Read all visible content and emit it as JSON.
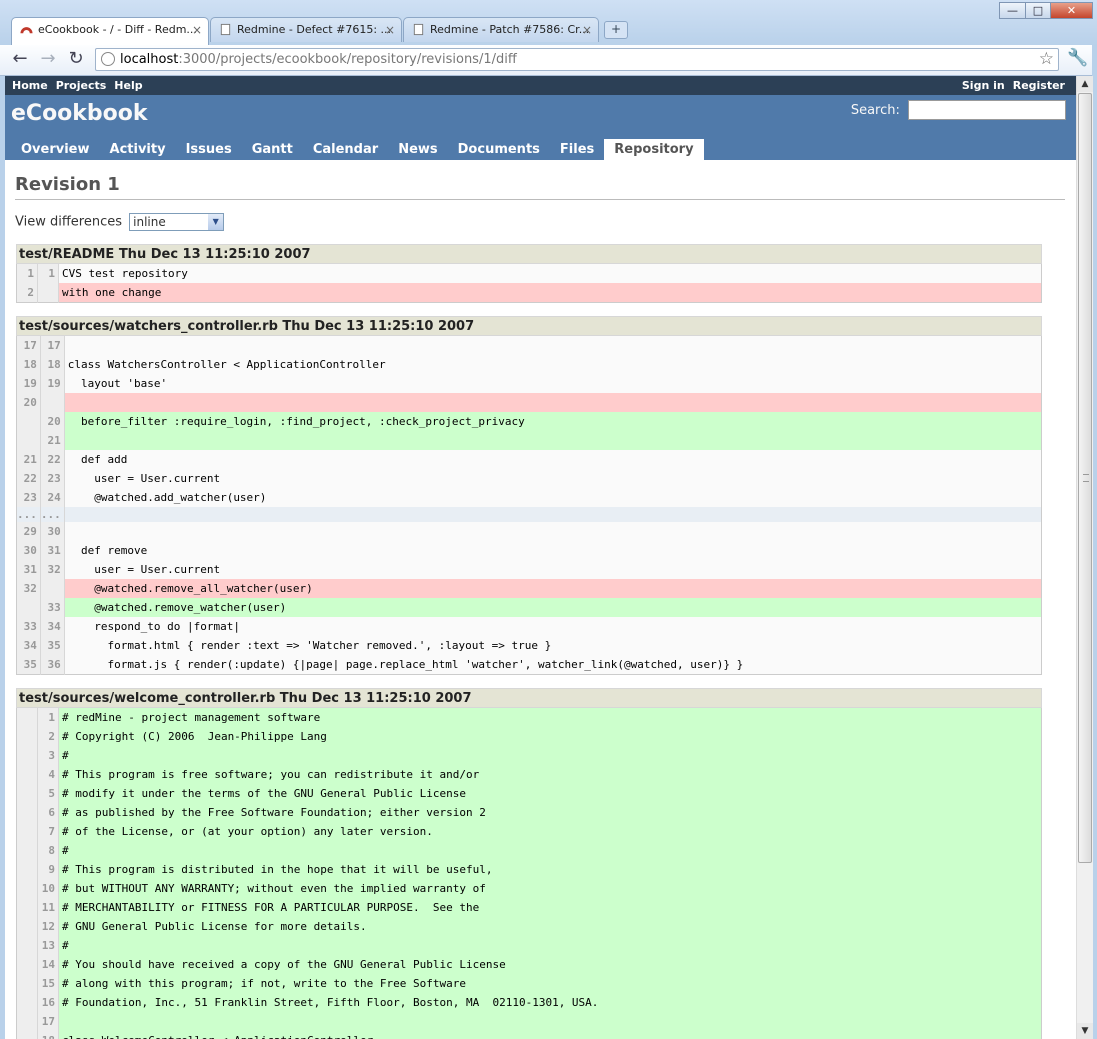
{
  "browser": {
    "tabs": [
      {
        "title": "eCookbook - / - Diff - Redm...",
        "active": true
      },
      {
        "title": "Redmine - Defect #7615: ...",
        "active": false
      },
      {
        "title": "Redmine - Patch #7586: Cr...",
        "active": false
      }
    ],
    "tab_close": "×",
    "new_tab": "+",
    "url_host": "localhost",
    "url_path": ":3000/projects/ecookbook/repository/revisions/1/diff",
    "window_buttons": {
      "minimize": "—",
      "maximize": "□",
      "close": "✕"
    },
    "icons": {
      "back": "back-arrow-icon",
      "forward": "forward-arrow-icon",
      "reload": "reload-icon",
      "star": "bookmark-star-icon",
      "wrench": "wrench-icon"
    }
  },
  "top_menu": {
    "left": [
      "Home",
      "Projects",
      "Help"
    ],
    "right": [
      "Sign in",
      "Register"
    ]
  },
  "header": {
    "title": "eCookbook",
    "search_label": "Search:",
    "search_value": ""
  },
  "main_menu": [
    "Overview",
    "Activity",
    "Issues",
    "Gantt",
    "Calendar",
    "News",
    "Documents",
    "Files",
    "Repository"
  ],
  "main_menu_selected": "Repository",
  "page": {
    "title": "Revision 1",
    "view_diff_label": "View differences",
    "view_diff_value": "inline"
  },
  "diffs": [
    {
      "filename": "test/README Thu Dec 13 11:25:10 2007",
      "rows": [
        {
          "old": "1",
          "new": "1",
          "type": "ctx",
          "code": "CVS test repository"
        },
        {
          "old": "2",
          "new": "",
          "type": "del",
          "code": "with one change"
        }
      ]
    },
    {
      "filename": "test/sources/watchers_controller.rb Thu Dec 13 11:25:10 2007",
      "rows": [
        {
          "old": "17",
          "new": "17",
          "type": "ctx",
          "code": ""
        },
        {
          "old": "18",
          "new": "18",
          "type": "ctx",
          "code": "class WatchersController < ApplicationController"
        },
        {
          "old": "19",
          "new": "19",
          "type": "ctx",
          "code": "  layout 'base'"
        },
        {
          "old": "20",
          "new": "",
          "type": "del",
          "code": ""
        },
        {
          "old": "",
          "new": "20",
          "type": "add",
          "code": "  before_filter :require_login, :find_project, :check_project_privacy"
        },
        {
          "old": "",
          "new": "21",
          "type": "add",
          "code": ""
        },
        {
          "old": "21",
          "new": "22",
          "type": "ctx",
          "code": "  def add"
        },
        {
          "old": "22",
          "new": "23",
          "type": "ctx",
          "code": "    user = User.current"
        },
        {
          "old": "23",
          "new": "24",
          "type": "ctx",
          "code": "    @watched.add_watcher(user)"
        },
        {
          "old": "...",
          "new": "...",
          "type": "gap",
          "code": ""
        },
        {
          "old": "29",
          "new": "30",
          "type": "ctx",
          "code": ""
        },
        {
          "old": "30",
          "new": "31",
          "type": "ctx",
          "code": "  def remove"
        },
        {
          "old": "31",
          "new": "32",
          "type": "ctx",
          "code": "    user = User.current"
        },
        {
          "old": "32",
          "new": "",
          "type": "del",
          "code": "    @watched.remove_all_watcher(user)"
        },
        {
          "old": "",
          "new": "33",
          "type": "add",
          "code": "    @watched.remove_watcher(user)"
        },
        {
          "old": "33",
          "new": "34",
          "type": "ctx",
          "code": "    respond_to do |format|"
        },
        {
          "old": "34",
          "new": "35",
          "type": "ctx",
          "code": "      format.html { render :text => 'Watcher removed.', :layout => true }"
        },
        {
          "old": "35",
          "new": "36",
          "type": "ctx",
          "code": "      format.js { render(:update) {|page| page.replace_html 'watcher', watcher_link(@watched, user)} }"
        }
      ]
    },
    {
      "filename": "test/sources/welcome_controller.rb Thu Dec 13 11:25:10 2007",
      "rows": [
        {
          "old": "",
          "new": "1",
          "type": "add",
          "code": "# redMine - project management software"
        },
        {
          "old": "",
          "new": "2",
          "type": "add",
          "code": "# Copyright (C) 2006  Jean-Philippe Lang"
        },
        {
          "old": "",
          "new": "3",
          "type": "add",
          "code": "#"
        },
        {
          "old": "",
          "new": "4",
          "type": "add",
          "code": "# This program is free software; you can redistribute it and/or"
        },
        {
          "old": "",
          "new": "5",
          "type": "add",
          "code": "# modify it under the terms of the GNU General Public License"
        },
        {
          "old": "",
          "new": "6",
          "type": "add",
          "code": "# as published by the Free Software Foundation; either version 2"
        },
        {
          "old": "",
          "new": "7",
          "type": "add",
          "code": "# of the License, or (at your option) any later version."
        },
        {
          "old": "",
          "new": "8",
          "type": "add",
          "code": "#"
        },
        {
          "old": "",
          "new": "9",
          "type": "add",
          "code": "# This program is distributed in the hope that it will be useful,"
        },
        {
          "old": "",
          "new": "10",
          "type": "add",
          "code": "# but WITHOUT ANY WARRANTY; without even the implied warranty of"
        },
        {
          "old": "",
          "new": "11",
          "type": "add",
          "code": "# MERCHANTABILITY or FITNESS FOR A PARTICULAR PURPOSE.  See the"
        },
        {
          "old": "",
          "new": "12",
          "type": "add",
          "code": "# GNU General Public License for more details."
        },
        {
          "old": "",
          "new": "13",
          "type": "add",
          "code": "#"
        },
        {
          "old": "",
          "new": "14",
          "type": "add",
          "code": "# You should have received a copy of the GNU General Public License"
        },
        {
          "old": "",
          "new": "15",
          "type": "add",
          "code": "# along with this program; if not, write to the Free Software"
        },
        {
          "old": "",
          "new": "16",
          "type": "add",
          "code": "# Foundation, Inc., 51 Franklin Street, Fifth Floor, Boston, MA  02110-1301, USA."
        },
        {
          "old": "",
          "new": "17",
          "type": "add",
          "code": ""
        },
        {
          "old": "",
          "new": "18",
          "type": "add",
          "code": "class WelcomeController < ApplicationController"
        }
      ]
    }
  ],
  "colors": {
    "header": "#507aaa",
    "top_menu": "#2c4056",
    "deleted": "#ffcccc",
    "added": "#ccffcc",
    "filename_bg": "#e4e4d4"
  }
}
